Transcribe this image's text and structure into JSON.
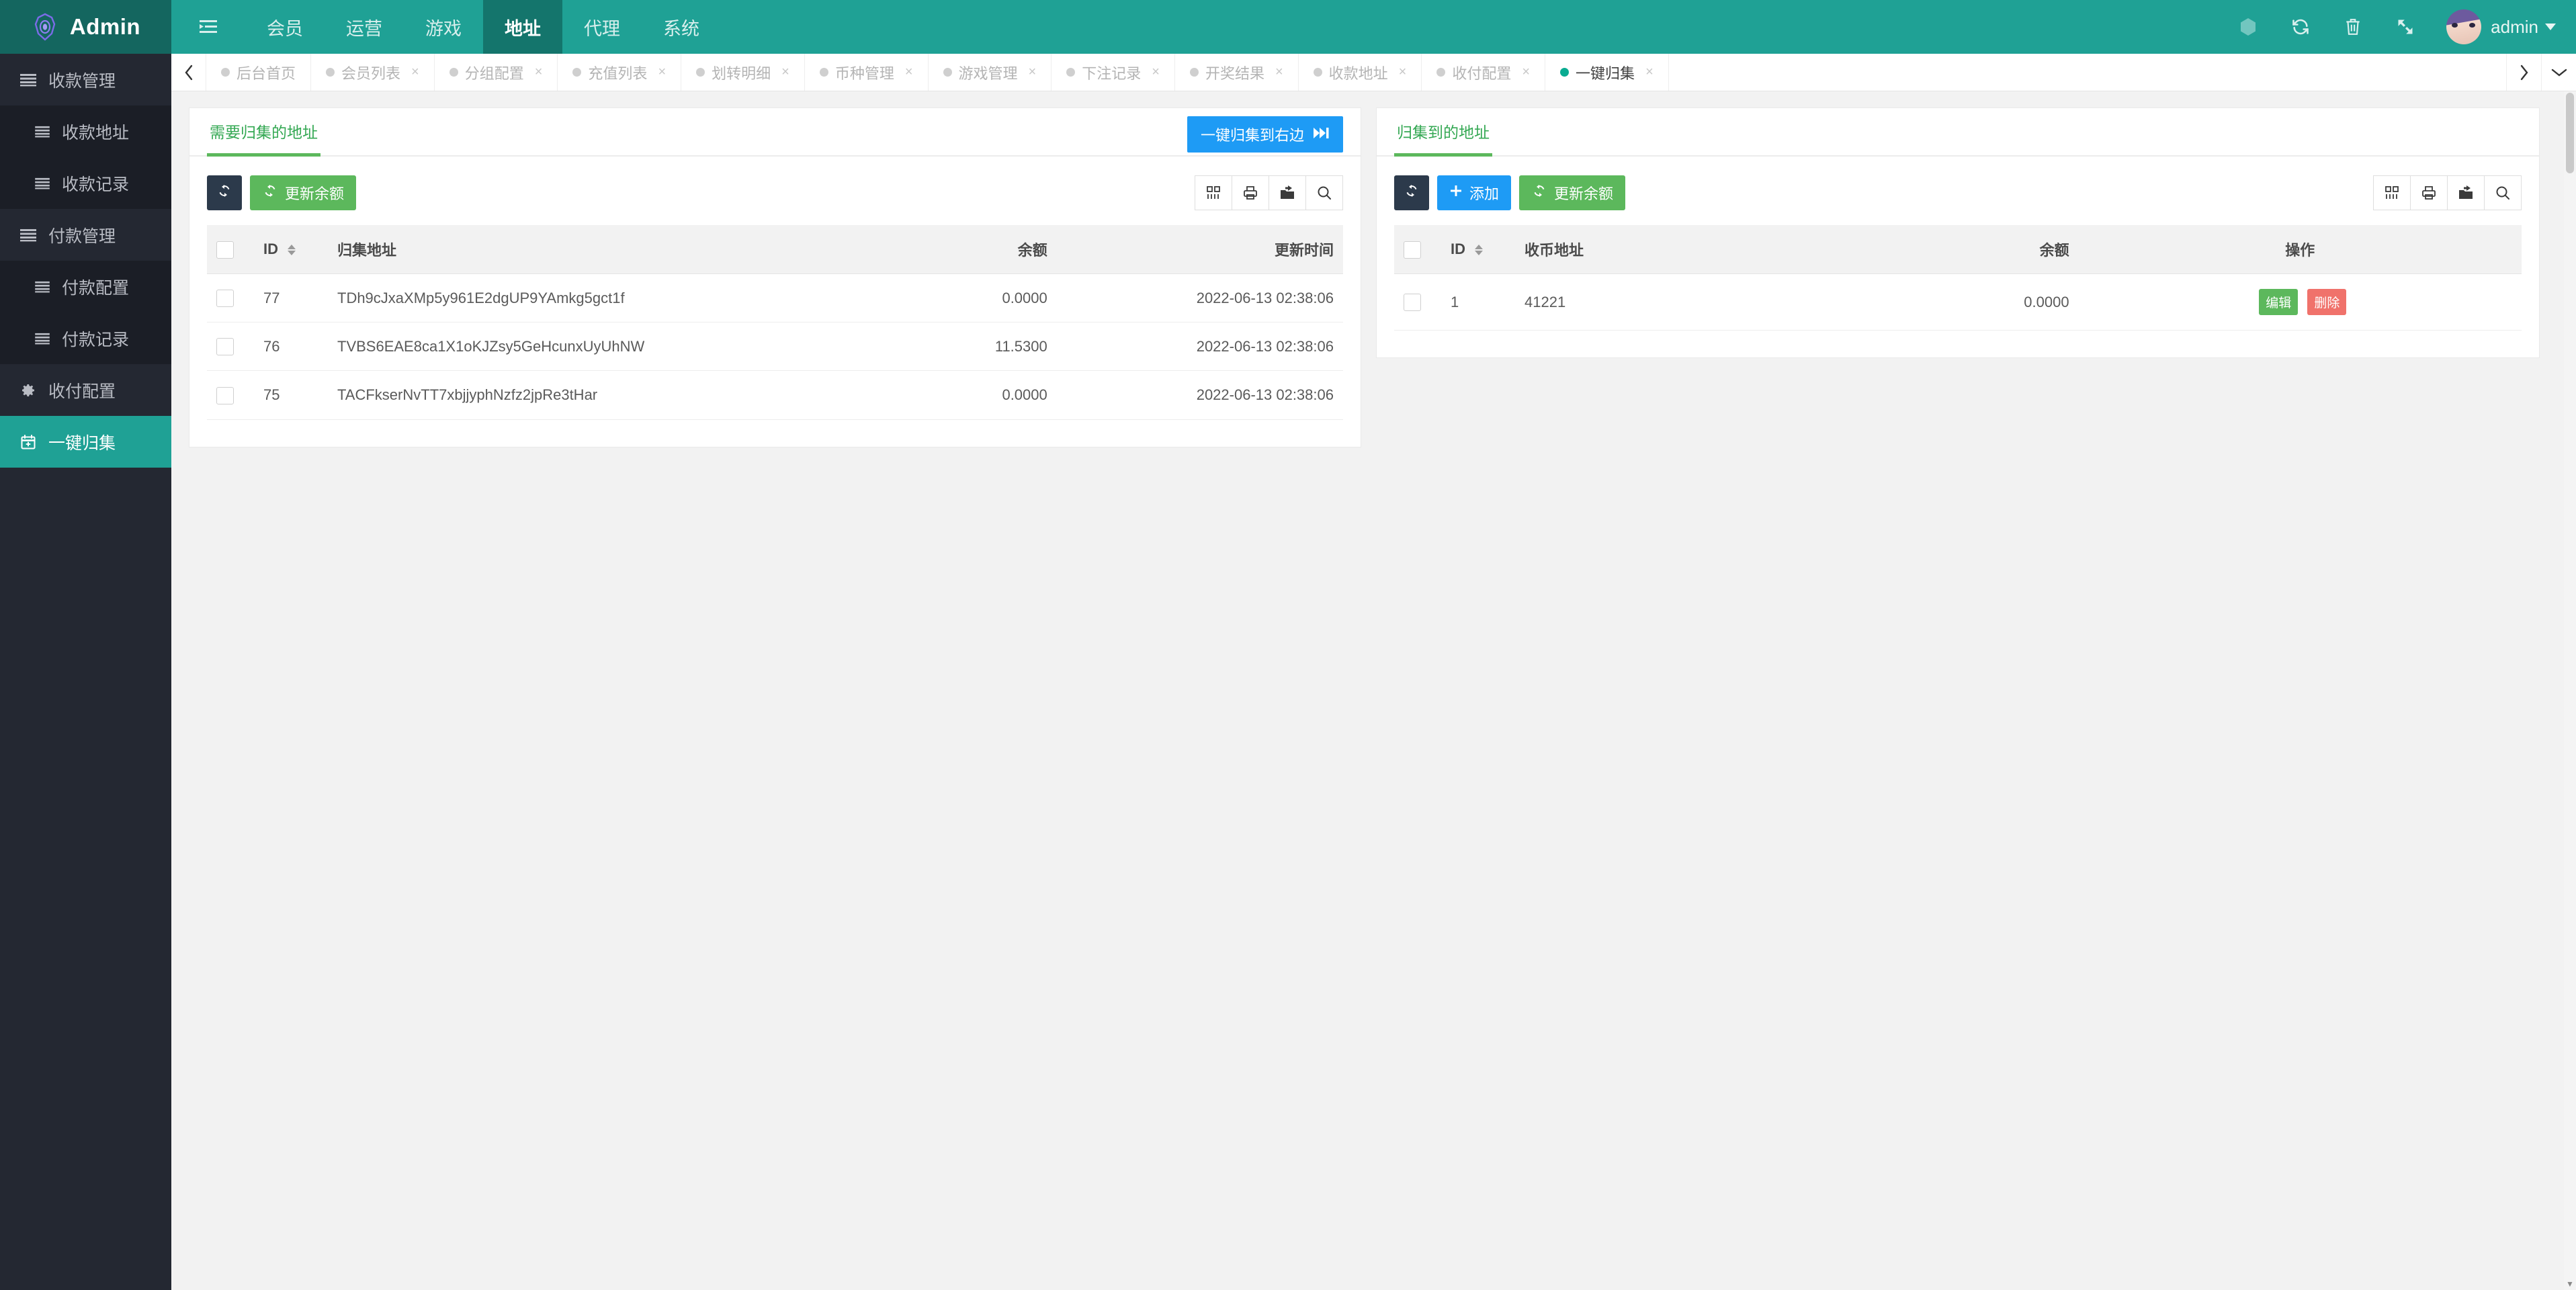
{
  "header": {
    "logo_text": "Admin",
    "logo_icon": "hexagon-eye-icon",
    "nav": [
      {
        "label": "",
        "icon": "hamburger-indent-icon",
        "active": false
      },
      {
        "label": "会员",
        "active": false
      },
      {
        "label": "运营",
        "active": false
      },
      {
        "label": "游戏",
        "active": false
      },
      {
        "label": "地址",
        "active": true
      },
      {
        "label": "代理",
        "active": false
      },
      {
        "label": "系统",
        "active": false
      }
    ],
    "right_icons": [
      "theme-hexagon-icon",
      "refresh-icon",
      "trash-icon",
      "fullscreen-icon"
    ],
    "user_name": "admin"
  },
  "sidebar": {
    "items": [
      {
        "label": "收款管理",
        "icon": "list-icon",
        "sub": false,
        "active": false
      },
      {
        "label": "收款地址",
        "icon": "list-icon",
        "sub": true,
        "active": false
      },
      {
        "label": "收款记录",
        "icon": "list-icon",
        "sub": true,
        "active": false
      },
      {
        "label": "付款管理",
        "icon": "list-icon",
        "sub": false,
        "active": false
      },
      {
        "label": "付款配置",
        "icon": "list-icon",
        "sub": true,
        "active": false
      },
      {
        "label": "付款记录",
        "icon": "list-icon",
        "sub": true,
        "active": false
      },
      {
        "label": "收付配置",
        "icon": "gear-icon",
        "sub": false,
        "active": false
      },
      {
        "label": "一键归集",
        "icon": "calendar-plus-icon",
        "sub": false,
        "active": true
      }
    ]
  },
  "tabbar": {
    "prev_icon": "chevron-left-icon",
    "next_icon": "chevron-right-icon",
    "menu_icon": "chevron-down-icon",
    "close_label": "×",
    "tabs": [
      {
        "label": "后台首页",
        "closable": false,
        "active": false
      },
      {
        "label": "会员列表",
        "closable": true,
        "active": false
      },
      {
        "label": "分组配置",
        "closable": true,
        "active": false
      },
      {
        "label": "充值列表",
        "closable": true,
        "active": false
      },
      {
        "label": "划转明细",
        "closable": true,
        "active": false
      },
      {
        "label": "币种管理",
        "closable": true,
        "active": false
      },
      {
        "label": "游戏管理",
        "closable": true,
        "active": false
      },
      {
        "label": "下注记录",
        "closable": true,
        "active": false
      },
      {
        "label": "开奖结果",
        "closable": true,
        "active": false
      },
      {
        "label": "收款地址",
        "closable": true,
        "active": false
      },
      {
        "label": "收付配置",
        "closable": true,
        "active": false
      },
      {
        "label": "一键归集",
        "closable": true,
        "active": true
      }
    ]
  },
  "left_panel": {
    "tab_label": "需要归集的地址",
    "head_button": {
      "label": "一键归集到右边",
      "icon": "fast-forward-icon"
    },
    "toolbar": {
      "refresh_icon": "refresh-icon",
      "refresh_balance_label": "更新余额",
      "tool_icons": [
        "columns-icon",
        "print-icon",
        "export-icon",
        "search-icon"
      ]
    },
    "table": {
      "columns": [
        "ID",
        "归集地址",
        "余额",
        "更新时间"
      ],
      "rows": [
        {
          "id": "77",
          "address": "TDh9cJxaXMp5y961E2dgUP9YAmkg5gct1f",
          "balance": "0.0000",
          "updated": "2022-06-13 02:38:06"
        },
        {
          "id": "76",
          "address": "TVBS6EAE8ca1X1oKJZsy5GeHcunxUyUhNW",
          "balance": "11.5300",
          "updated": "2022-06-13 02:38:06"
        },
        {
          "id": "75",
          "address": "TACFkserNvTT7xbjjyphNzfz2jpRe3tHar",
          "balance": "0.0000",
          "updated": "2022-06-13 02:38:06"
        }
      ]
    }
  },
  "right_panel": {
    "tab_label": "归集到的地址",
    "toolbar": {
      "refresh_icon": "refresh-icon",
      "add_label": "添加",
      "refresh_balance_label": "更新余额",
      "tool_icons": [
        "columns-icon",
        "print-icon",
        "export-icon",
        "search-icon"
      ]
    },
    "table": {
      "columns": [
        "ID",
        "收币地址",
        "余额",
        "操作"
      ],
      "rows": [
        {
          "id": "1",
          "address": "41221",
          "balance": "0.0000",
          "edit_label": "编辑",
          "delete_label": "删除"
        }
      ]
    }
  },
  "colors": {
    "brand_teal": "#1fa195",
    "brand_teal_dark": "#14665f",
    "sidebar_bg": "#242832",
    "accent_green": "#5cb85c",
    "accent_blue": "#1e9bf5",
    "accent_red": "#f0726b"
  }
}
